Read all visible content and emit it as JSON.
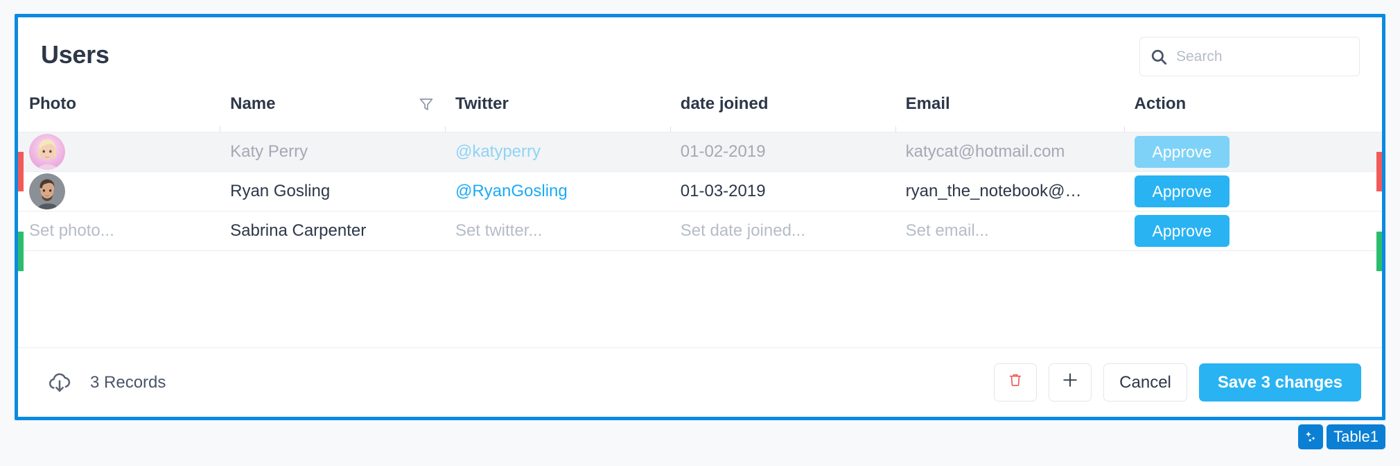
{
  "widget": {
    "title": "Users",
    "badges": {
      "ai_icon": "sparkles-icon",
      "table_label": "Table1"
    }
  },
  "search": {
    "icon": "search-icon",
    "value": "",
    "placeholder": "Search"
  },
  "table": {
    "columns": [
      {
        "key": "photo",
        "label": "Photo",
        "has_filter": false
      },
      {
        "key": "name",
        "label": "Name",
        "has_filter": true,
        "filter_icon": "funnel-icon"
      },
      {
        "key": "twitter",
        "label": "Twitter",
        "has_filter": false
      },
      {
        "key": "date",
        "label": "date joined",
        "has_filter": false
      },
      {
        "key": "email",
        "label": "Email",
        "has_filter": false
      },
      {
        "key": "action",
        "label": "Action",
        "has_filter": false
      }
    ],
    "rows": [
      {
        "status": "modified",
        "status_color": "#f25a5a",
        "dimmed": true,
        "photo": {
          "type": "avatar",
          "alt": "Katy Perry photo",
          "bg": "#f0b6e0"
        },
        "name": "Katy Perry",
        "twitter": "@katyperry",
        "date": "01-02-2019",
        "email": "katycat@hotmail.com",
        "action_label": "Approve"
      },
      {
        "status": "none",
        "status_color": "",
        "dimmed": false,
        "photo": {
          "type": "avatar",
          "alt": "Ryan Gosling photo",
          "bg": "#8b8f96"
        },
        "name": "Ryan Gosling",
        "twitter": "@RyanGosling",
        "date": "01-03-2019",
        "email": "ryan_the_notebook@…",
        "action_label": "Approve"
      },
      {
        "status": "new",
        "status_color": "#2bbd6e",
        "dimmed": false,
        "photo": {
          "type": "placeholder",
          "text": "Set photo..."
        },
        "name": "Sabrina Carpenter",
        "twitter": "Set twitter...",
        "twitter_is_placeholder": true,
        "date": "Set date joined...",
        "date_is_placeholder": true,
        "email": "Set email...",
        "email_is_placeholder": true,
        "action_label": "Approve"
      }
    ]
  },
  "footer": {
    "export_icon": "cloud-download-icon",
    "records_text": "3 Records",
    "delete_icon": "trash-icon",
    "add_icon": "plus-icon",
    "cancel_label": "Cancel",
    "save_label": "Save 3 changes"
  },
  "colors": {
    "accent": "#29b3f2",
    "selection_border": "#0b8ae0",
    "status_modified": "#f25a5a",
    "status_new": "#2bbd6e",
    "link": "#1cabf2",
    "badge": "#0b7fd4"
  }
}
